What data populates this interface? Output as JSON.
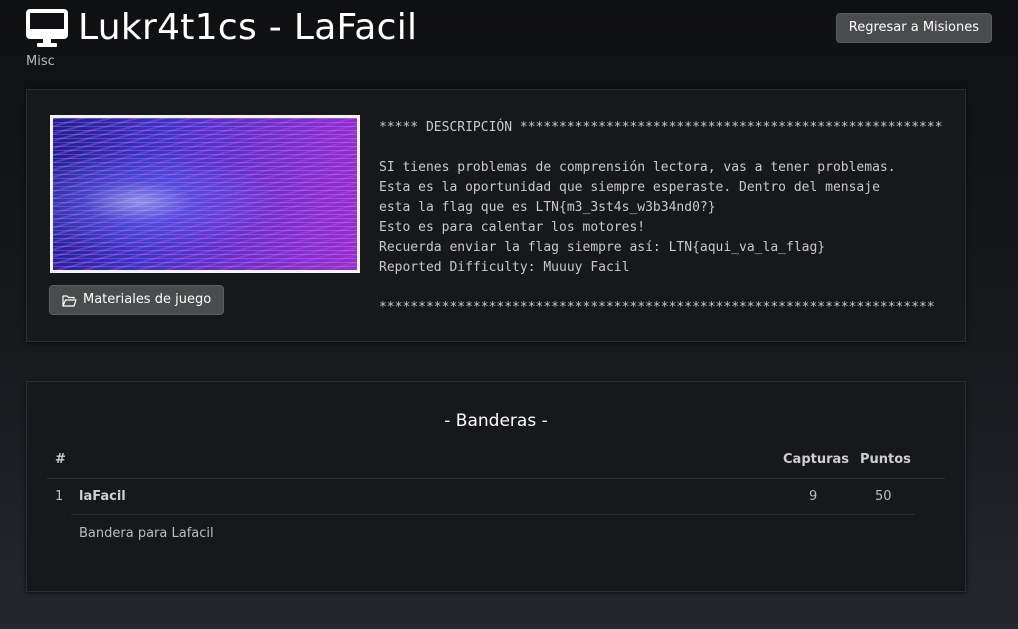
{
  "header": {
    "title": "Lukr4t1cs - LaFacil",
    "category": "Misc",
    "back_button_label": "Regresar a Misiones",
    "title_icon": "desktop-monitor-icon"
  },
  "challenge": {
    "materials_button_label": "Materiales de juego",
    "materials_icon": "folder-open-icon",
    "description": "***** DESCRIPCIÓN ******************************************************\n\nSI tienes problemas de comprensión lectora, vas a tener problemas.\nEsta es la oportunidad que siempre esperaste. Dentro del mensaje\nesta la flag que es LTN{m3_3st4s_w3b34nd0?}\nEsto es para calentar los motores!\nRecuerda enviar la flag siempre así: LTN{aqui_va_la_flag}\nReported Difficulty: Muuuy Facil\n\n***********************************************************************"
  },
  "flags": {
    "title": "- Banderas -",
    "columns": {
      "number": "#",
      "captures": "Capturas",
      "points": "Puntos"
    },
    "rows": [
      {
        "number": "1",
        "name": "laFacil",
        "captures": "9",
        "points": "50",
        "description": "Bandera para Lafacil"
      }
    ]
  },
  "colors": {
    "background": "#17191d",
    "panel": "#17181b",
    "button": "#4a4b4d",
    "text": "#d8d8d8"
  }
}
